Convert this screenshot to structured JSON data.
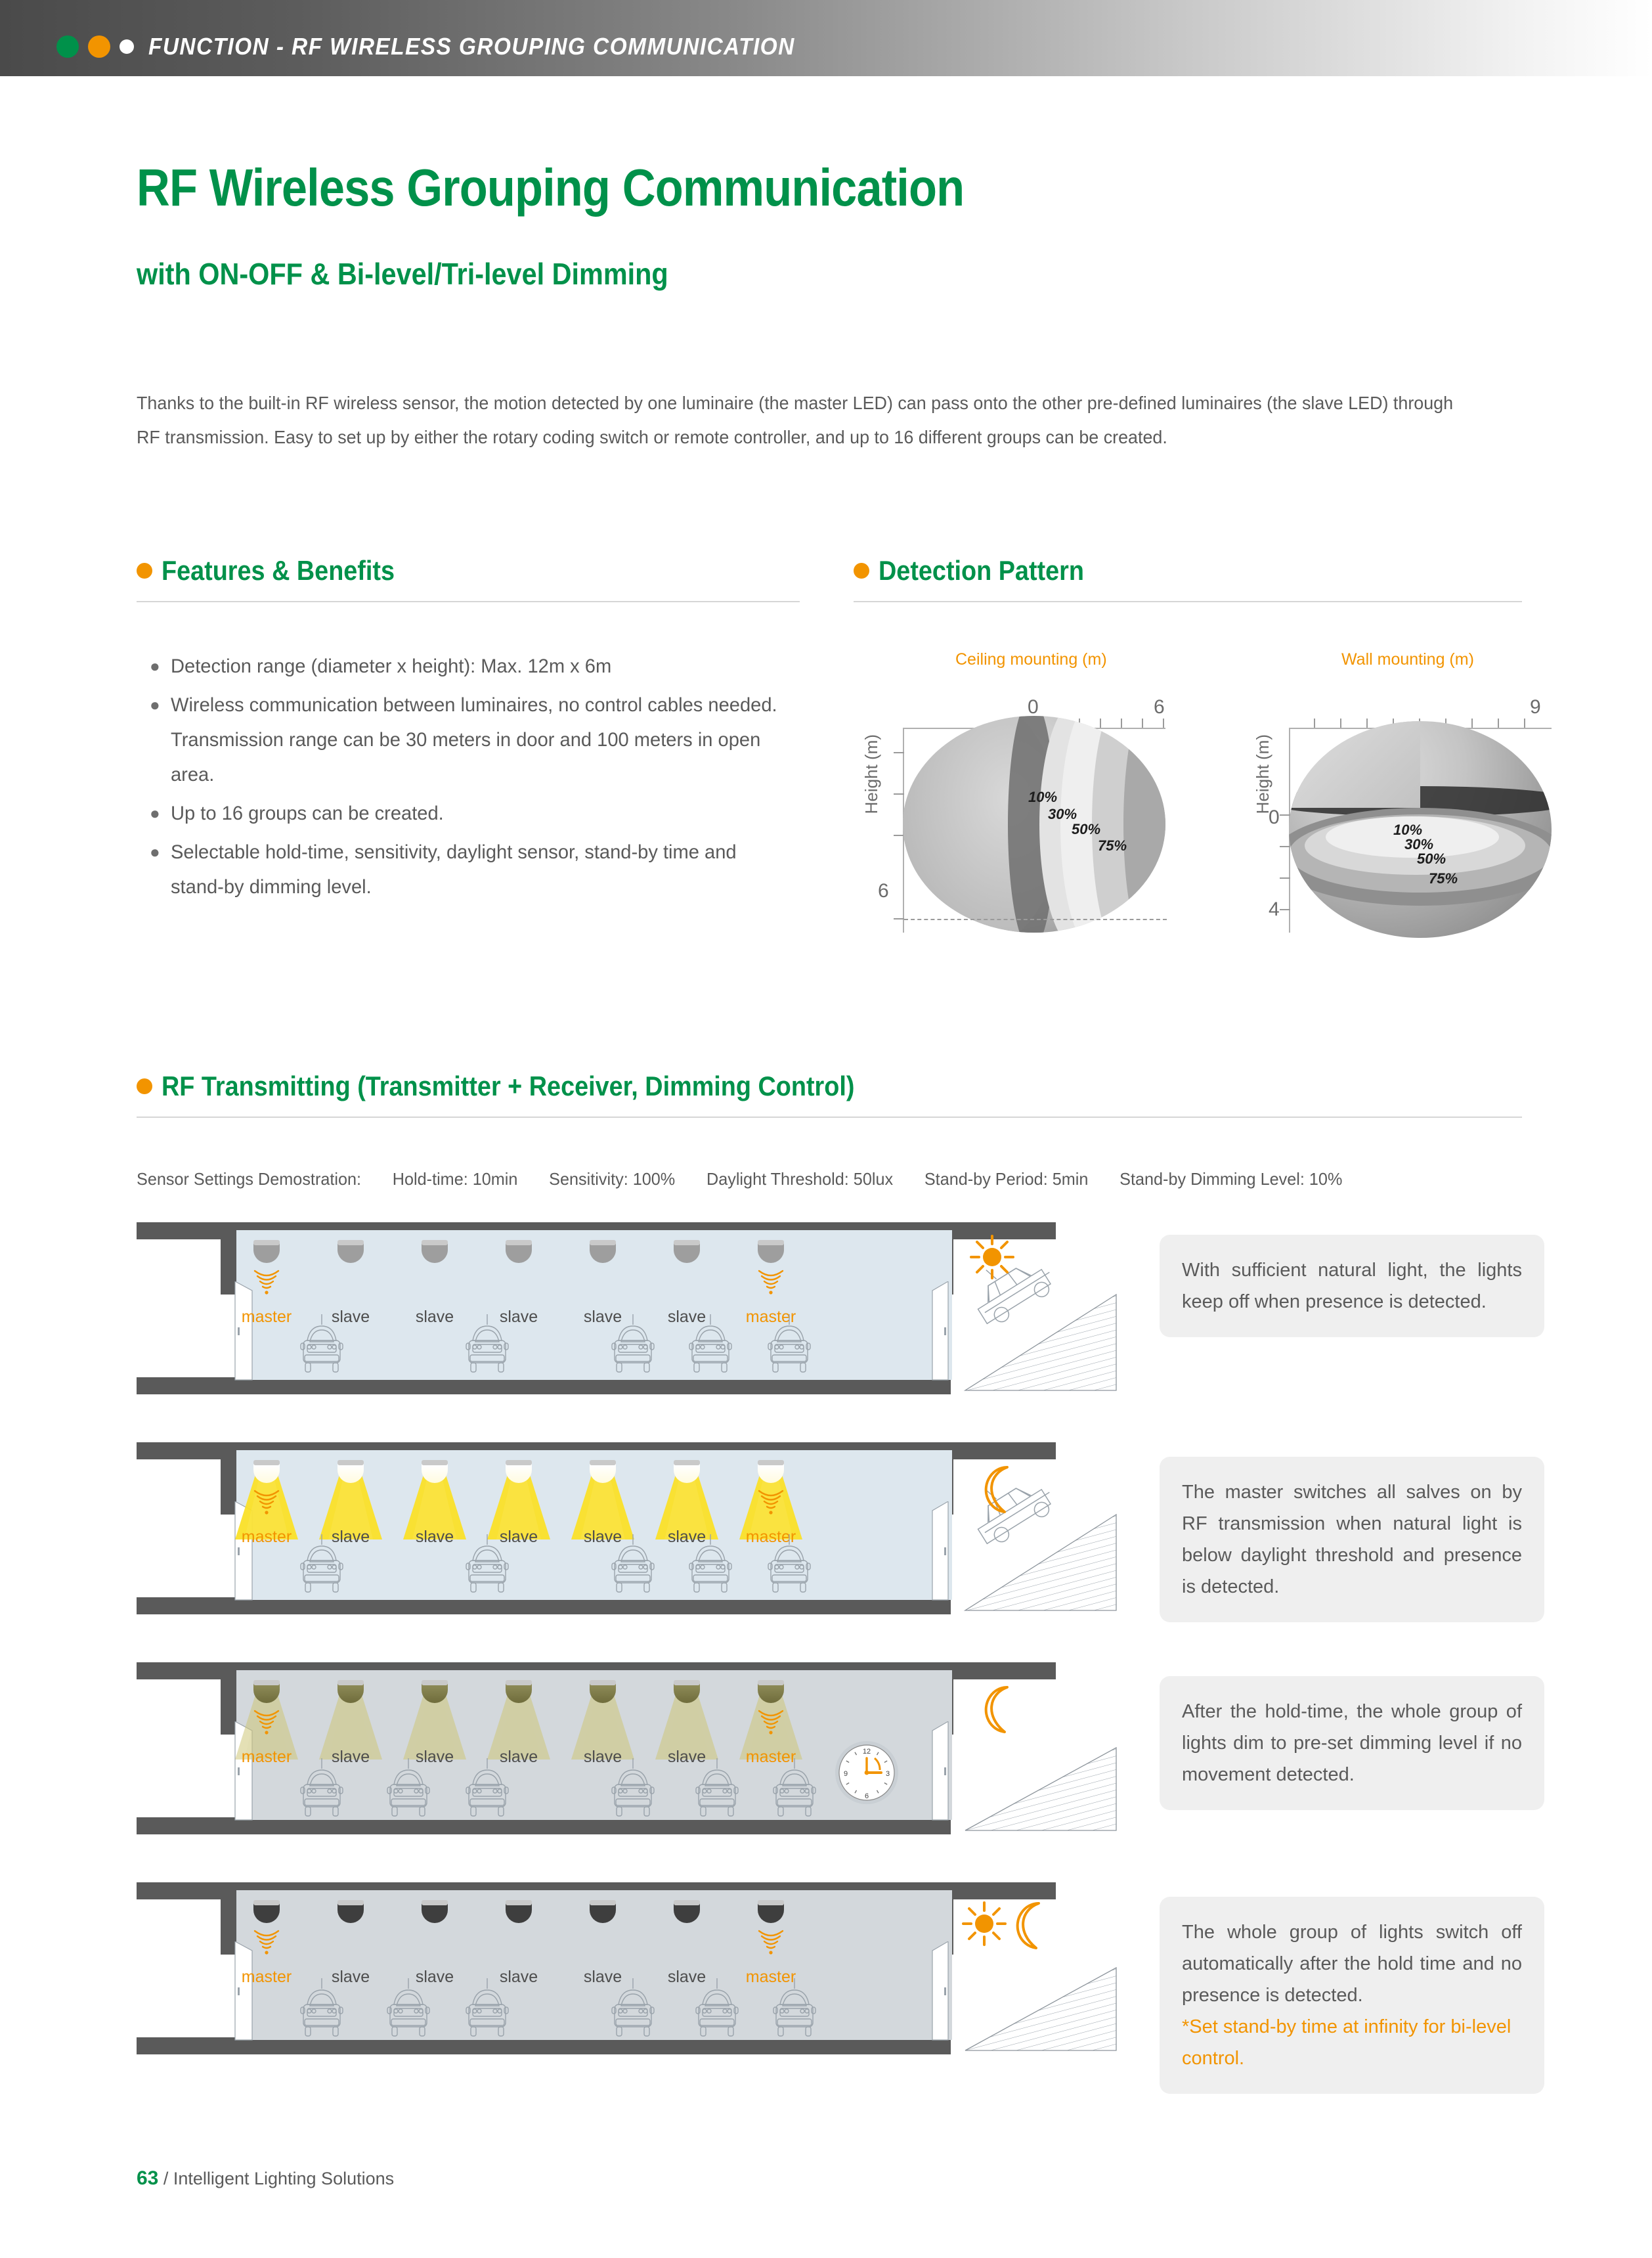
{
  "header": {
    "title": "FUNCTION - RF WIRELESS GROUPING COMMUNICATION",
    "dots": [
      "#00914A",
      "#F29400",
      "#FFFFFF"
    ]
  },
  "page": {
    "title": "RF Wireless Grouping Communication",
    "subtitle": "with ON-OFF & Bi-level/Tri-level Dimming",
    "intro": "Thanks to the built-in RF wireless sensor, the motion detected by one luminaire (the master LED) can pass onto the other pre-defined luminaires (the slave LED) through RF transmission. Easy to set up by either the rotary coding switch or remote controller, and up to 16 different groups can be created.",
    "accent_green": "#00914A",
    "accent_orange": "#F29400"
  },
  "features": {
    "heading": "Features & Benefits",
    "items": [
      "Detection range (diameter x height): Max. 12m x 6m",
      "Wireless communication between luminaires, no control cables needed. Transmission range can be 30 meters in door and 100 meters in open area.",
      "Up to 16 groups can be created.",
      "Selectable hold-time, sensitivity, daylight sensor, stand-by time and stand-by dimming level."
    ]
  },
  "detection": {
    "heading": "Detection Pattern",
    "charts": [
      {
        "label": "Ceiling mounting (m)",
        "axis_y_label": "Height (m)",
        "x_ticks": [
          "0",
          "6"
        ],
        "y_ticks": [
          "6"
        ],
        "zones": [
          "10%",
          "30%",
          "50%",
          "75%"
        ]
      },
      {
        "label": "Wall mounting (m)",
        "axis_y_label": "Height (m)",
        "x_ticks": [
          "9"
        ],
        "y_ticks": [
          "0",
          "4"
        ],
        "zones": [
          "10%",
          "30%",
          "50%",
          "75%"
        ]
      }
    ]
  },
  "chart_data": [
    {
      "type": "area",
      "title": "Ceiling mounting (m)",
      "xlabel": "",
      "ylabel": "Height (m)",
      "xlim": [
        0,
        6
      ],
      "ylim": [
        0,
        6
      ],
      "x_tick_labels": [
        "0",
        "6"
      ],
      "y_tick_labels": [
        "6"
      ],
      "series": [
        {
          "name": "10%",
          "sensitivity": 10
        },
        {
          "name": "30%",
          "sensitivity": 30
        },
        {
          "name": "50%",
          "sensitivity": 50
        },
        {
          "name": "75%",
          "sensitivity": 75
        }
      ],
      "grid": false,
      "legend": "inline-annotations"
    },
    {
      "type": "area",
      "title": "Wall mounting (m)",
      "xlabel": "",
      "ylabel": "Height (m)",
      "xlim": [
        0,
        9
      ],
      "ylim": [
        -4,
        4
      ],
      "x_tick_labels": [
        "9"
      ],
      "y_tick_labels": [
        "0",
        "4"
      ],
      "series": [
        {
          "name": "10%",
          "sensitivity": 10
        },
        {
          "name": "30%",
          "sensitivity": 30
        },
        {
          "name": "50%",
          "sensitivity": 50
        },
        {
          "name": "75%",
          "sensitivity": 75
        }
      ],
      "grid": false,
      "legend": "inline-annotations"
    }
  ],
  "rf": {
    "heading": "RF Transmitting (Transmitter + Receiver, Dimming Control)",
    "settings_prefix": "Sensor Settings Demostration:",
    "settings": [
      "Hold-time: 10min",
      "Sensitivity: 100%",
      "Daylight Threshold: 50lux",
      "Stand-by Period: 5min",
      "Stand-by Dimming Level: 10%"
    ],
    "luminaire_labels": [
      "master",
      "slave",
      "slave",
      "slave",
      "slave",
      "slave",
      "master"
    ],
    "scenes": [
      {
        "state": "off",
        "weather_icons": [
          "sun"
        ],
        "cars_inside": 5,
        "car_on_ramp": true,
        "clock": false,
        "callout": "With sufficient natural light, the lights keep off when presence is detected.",
        "callout_note": ""
      },
      {
        "state": "full",
        "weather_icons": [
          "moon"
        ],
        "cars_inside": 5,
        "car_on_ramp": true,
        "clock": false,
        "callout": "The master switches all salves on by RF transmission when natural light is below daylight threshold and presence is detected.",
        "callout_note": ""
      },
      {
        "state": "dimmed",
        "weather_icons": [
          "moon"
        ],
        "cars_inside": 6,
        "car_on_ramp": false,
        "clock": true,
        "clock_numerals": [
          "12",
          "3",
          "6",
          "9"
        ],
        "callout": "After the hold-time, the whole group of lights dim to pre-set dimming level if no movement detected.",
        "callout_note": ""
      },
      {
        "state": "off-dark",
        "weather_icons": [
          "sun",
          "moon"
        ],
        "cars_inside": 6,
        "car_on_ramp": false,
        "clock": false,
        "callout": "The whole group of lights switch off automatically after the hold time and no presence is detected.",
        "callout_note": "*Set stand-by time at infinity for bi-level control."
      }
    ]
  },
  "footer": {
    "page_number": "63",
    "text": "/ Intelligent Lighting Solutions"
  }
}
